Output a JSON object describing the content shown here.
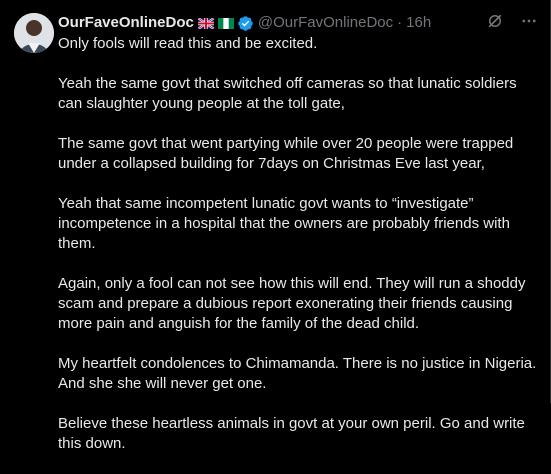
{
  "tweet": {
    "author_name": "OurFaveOnlineDoc",
    "handle": "@OurFavOnlineDoc",
    "separator": "·",
    "time": "16h",
    "flags": [
      "uk-flag-icon",
      "nigeria-flag-icon"
    ],
    "verified_color": "#1d9bf0",
    "paragraphs": [
      "Only fools will read this and be excited.",
      "Yeah the same govt that switched off cameras so that lunatic soldiers can slaughter young people at the toll gate,",
      "The same govt that went partying while over 20 people were trapped under a collapsed building for 7days on Christmas Eve last year,",
      "Yeah that same incompetent lunatic govt wants to “investigate” incompetence in a hospital that the owners are probably friends with them.",
      "Again, only a fool can not see how this will end. They will run a shoddy scam and prepare a dubious report exonerating their friends causing more pain and anguish for the family of the dead child.",
      "My heartfelt condolences to Chimamanda. There is no justice in Nigeria. And she she will never get one.",
      "Believe these heartless animals in govt at your own peril. Go and write this down."
    ]
  }
}
